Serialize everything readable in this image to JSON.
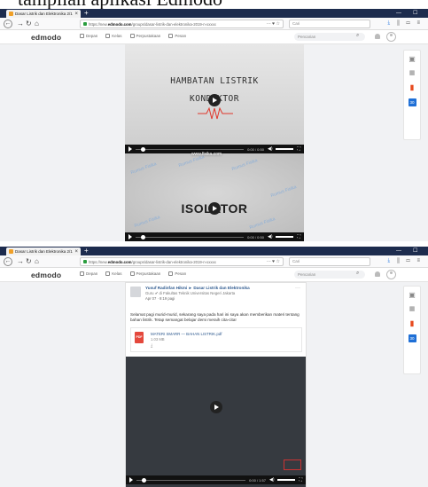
{
  "caption": "tampilan aplikasi Edmodo",
  "browser": {
    "tab_title": "Dasar Listrik dan Elektronika 2/1",
    "tab_close": "×",
    "tab_new": "+",
    "window_minimize": "—",
    "window_maximize": "☐",
    "url_prefix": "https://new.",
    "url_domain": "edmodo.com",
    "url_rest": "/groups/dasar-listrik-dan-elektronika-2019-n-xxxxx",
    "url_actions": "··· ♥ ☆",
    "search_placeholder": "Cari"
  },
  "edmodo": {
    "logo": "edmodo",
    "nav": [
      "Depan",
      "Kelas",
      "Perpustakaan",
      "Pesan"
    ],
    "search_placeholder": "Pencarian"
  },
  "side_rail": {
    "calendar_label": "30"
  },
  "video1": {
    "title_line1": "HAMBATAN LISTRIK",
    "title_line2": "KONDUKTOR",
    "time": "0:00 / 0:50",
    "site_watermark": "www.fisika.com",
    "watermark": "Rumus Fisika",
    "slide2_title": "ISOLATOR"
  },
  "post": {
    "author": "Yusuf Radinfan Hikmi ► Dasar Listrik dan Elektronika",
    "role": "Guru ✔ di Fakultas Teknik Universitas Negeri Jakarta",
    "meta": "Apr 07 · 9:19 pagi",
    "more": "···",
    "body": "Selamat pagi murid-murid, sekarang saya pada hari ini saya akan memberikan materi tentang bahan listrik. Tetap semangat belajar demi meraih cita-cita!",
    "attachment_name": "MATERI SMARR — BAHAN LISTRIK.pdf",
    "attachment_size": "1.03 MB",
    "pdf_label": "PDF",
    "download_icon": "⤓",
    "video_time": "0:00 / 1:57"
  }
}
